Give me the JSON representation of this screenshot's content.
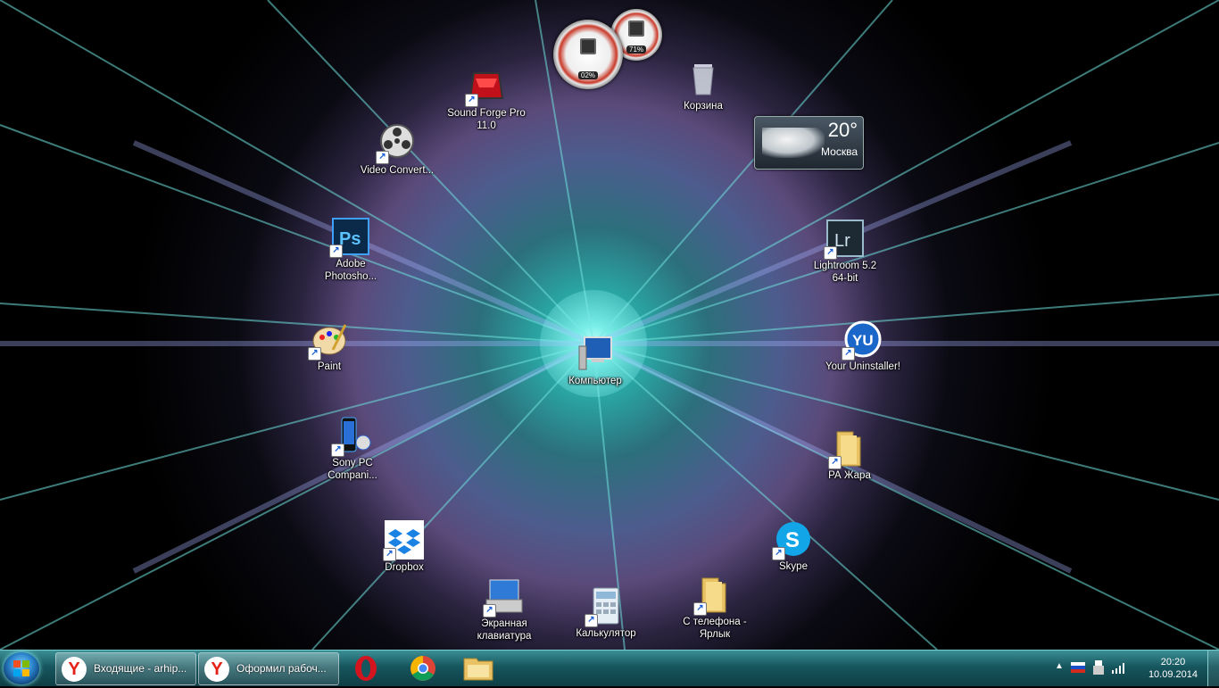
{
  "desktop": {
    "icons": [
      {
        "key": "sound-forge",
        "label": "Sound Forge Pro 11.0"
      },
      {
        "key": "recycle-bin",
        "label": "Корзина"
      },
      {
        "key": "video-converter",
        "label": "Video Convert..."
      },
      {
        "key": "photoshop",
        "label": "Adobe Photosho..."
      },
      {
        "key": "lightroom",
        "label": "Lightroom 5.2 64-bit"
      },
      {
        "key": "paint",
        "label": "Paint"
      },
      {
        "key": "computer",
        "label": "Компьютер"
      },
      {
        "key": "your-uninstaller",
        "label": "Your Uninstaller!"
      },
      {
        "key": "sony-pc-companion",
        "label": "Sony PC Compani..."
      },
      {
        "key": "pa-zhara",
        "label": "РА Жара"
      },
      {
        "key": "dropbox",
        "label": "Dropbox"
      },
      {
        "key": "skype",
        "label": "Skype"
      },
      {
        "key": "onscreen-keyboard",
        "label": "Экранная клавиатура"
      },
      {
        "key": "calculator",
        "label": "Калькулятор"
      },
      {
        "key": "from-phone",
        "label": "С телефона - Ярлык"
      }
    ]
  },
  "gadgets": {
    "cpu_value": "02%",
    "mem_value": "71%",
    "weather": {
      "temp": "20°",
      "city": "Москва"
    }
  },
  "taskbar": {
    "windows": [
      {
        "label": "Входящие - arhip..."
      },
      {
        "label": "Оформил рабоч..."
      }
    ],
    "pinned": [
      "opera-icon",
      "chrome-icon",
      "explorer-icon"
    ],
    "clock_time": "20:20",
    "clock_date": "10.09.2014"
  },
  "colors": {
    "taskbar": "#17565e",
    "accent": "#2aa6a4"
  }
}
